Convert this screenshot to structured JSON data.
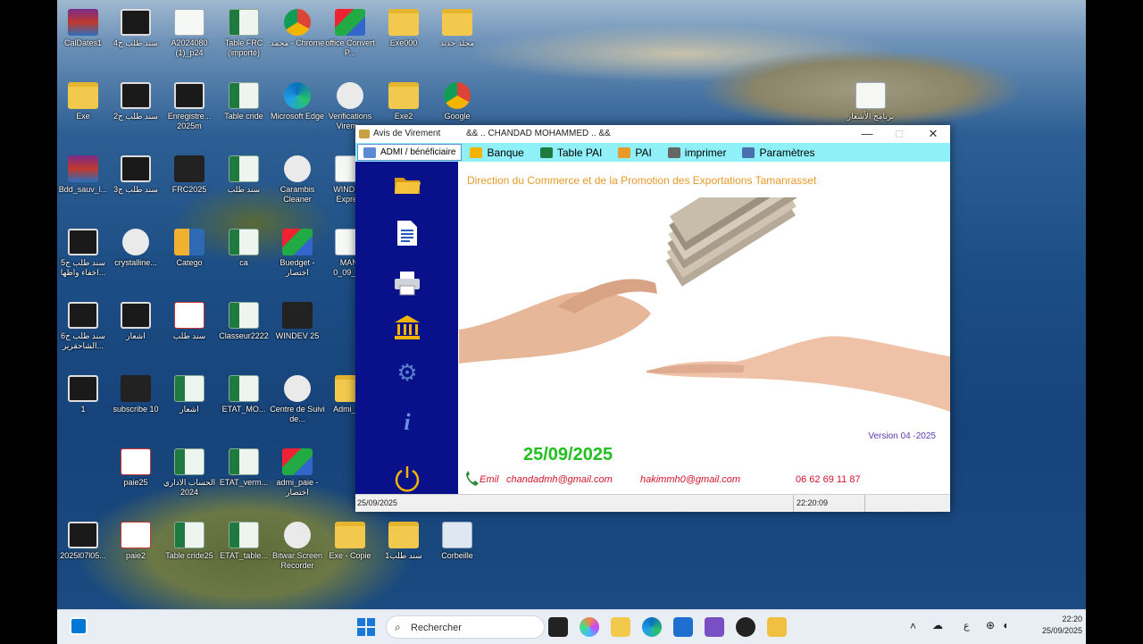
{
  "desktop": {
    "icons": [
      {
        "label": "CalDates1",
        "type": "rar"
      },
      {
        "label": "سند طلب ج4",
        "type": "film"
      },
      {
        "label": "A2024080 (1)_p24",
        "type": "sheet"
      },
      {
        "label": "Table FRC (importé)",
        "type": "xl"
      },
      {
        "label": "محمد - Chrome",
        "type": "chrome"
      },
      {
        "label": "office Convert P...",
        "type": "rgb"
      },
      {
        "label": "Exe000",
        "type": "folder"
      },
      {
        "label": "مجلد جديد",
        "type": "folder"
      },
      {
        "label": "Exe",
        "type": "folder"
      },
      {
        "label": "سند طلب ج2",
        "type": "film"
      },
      {
        "label": "Enregistre... 2025m",
        "type": "film"
      },
      {
        "label": "Table cride",
        "type": "xl"
      },
      {
        "label": "Microsoft Edge",
        "type": "edge"
      },
      {
        "label": "Verifications Virem...",
        "type": "round"
      },
      {
        "label": "Exe2",
        "type": "folder"
      },
      {
        "label": "Google",
        "type": "chrome"
      },
      {
        "label": "برنامج الأشعار",
        "type": "sheet"
      },
      {
        "label": "Bdd_sauv_l...",
        "type": "rar"
      },
      {
        "label": "سند طلب ج3",
        "type": "film"
      },
      {
        "label": "FRC2025",
        "type": "dark"
      },
      {
        "label": "سند طلب",
        "type": "xl"
      },
      {
        "label": "Carambis Cleaner",
        "type": "round"
      },
      {
        "label": "WINDE... Expre...",
        "type": "sheet"
      },
      {
        "label": "سند طلب ج5 اخفاء واظها...",
        "type": "film"
      },
      {
        "label": "crystalline...",
        "type": "round"
      },
      {
        "label": "Catego",
        "type": "hf"
      },
      {
        "label": "ca",
        "type": "xl"
      },
      {
        "label": "Buedget - اختصار",
        "type": "rgb"
      },
      {
        "label": "MANI 0_09_2...",
        "type": "sheet"
      },
      {
        "label": "سند طلب ج6 الشاحقرير...",
        "type": "film"
      },
      {
        "label": "اشعار",
        "type": "film"
      },
      {
        "label": "سند طلب",
        "type": "pdf"
      },
      {
        "label": "Classeur2222",
        "type": "xl"
      },
      {
        "label": "WINDEV 25",
        "type": "dark"
      },
      {
        "label": "1",
        "type": "film"
      },
      {
        "label": "subscribe 10",
        "type": "dark"
      },
      {
        "label": "اشعار",
        "type": "xl"
      },
      {
        "label": "ETAT_MO...",
        "type": "xl"
      },
      {
        "label": "Centre de Suivi de...",
        "type": "round"
      },
      {
        "label": "Admi_P...",
        "type": "folder"
      },
      {
        "label": "paie25",
        "type": "pdf"
      },
      {
        "label": "الحساب الاداري 2024",
        "type": "xl"
      },
      {
        "label": "ETAT_verm...",
        "type": "xl"
      },
      {
        "label": "admi_paie - اختصار",
        "type": "rgb"
      },
      {
        "label": "2025l07l05...",
        "type": "film"
      },
      {
        "label": "paie2",
        "type": "pdf"
      },
      {
        "label": "Table cride25",
        "type": "xl"
      },
      {
        "label": "ETAT_table...",
        "type": "xl"
      },
      {
        "label": "Bitwar Screen Recorder",
        "type": "round"
      },
      {
        "label": "Exe - Copie",
        "type": "folder"
      },
      {
        "label": "سند طلب1",
        "type": "folder"
      },
      {
        "label": "Corbeille",
        "type": "bin"
      }
    ]
  },
  "window": {
    "app_name": "Avis de Virement",
    "title": "&&  .. CHANDAD MOHAMMED .. &&",
    "controls": {
      "minimize": "—",
      "maximize": "□",
      "close": "✕"
    },
    "menu": [
      {
        "label": "ADMI / bénéficiaire",
        "color": "#5a8bd4"
      },
      {
        "label": "Banque",
        "color": "#f4b400"
      },
      {
        "label": "Table PAI",
        "color": "#1f7a3f"
      },
      {
        "label": "PAI",
        "color": "#e89a2a"
      },
      {
        "label": "imprimer",
        "color": "#666666"
      },
      {
        "label": "Paramètres",
        "color": "#4a6fb0"
      }
    ],
    "sidebar_icons": [
      "open-folder-icon",
      "document-icon",
      "printer-icon",
      "bank-icon",
      "settings-icon",
      "info-icon",
      "power-icon"
    ],
    "content": {
      "heading": "Direction du Commerce et de la Promotion des Exportations Tamanrasset",
      "version": "Version 04 -2025",
      "date": "25/09/2025",
      "email_label": "Emil",
      "email1": "chandadmh@gmail.com",
      "email2": "hakimmh0@gmail.com",
      "phone": "06 62 69 11 87"
    },
    "status": {
      "date": "25/09/2025",
      "time": "22:20:09"
    }
  },
  "taskbar": {
    "search_placeholder": "Rechercher",
    "clock_time": "22:20",
    "clock_date": "25/09/2025",
    "lang": "ع"
  }
}
